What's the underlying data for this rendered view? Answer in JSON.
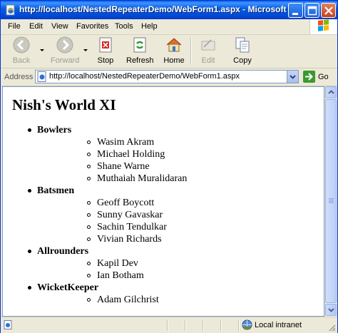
{
  "window": {
    "title": "http://localhost/NestedRepeaterDemo/WebForm1.aspx - Microsoft ..."
  },
  "menu": [
    "File",
    "Edit",
    "View",
    "Favorites",
    "Tools",
    "Help"
  ],
  "toolbar": {
    "back": "Back",
    "forward": "Forward",
    "stop": "Stop",
    "refresh": "Refresh",
    "home": "Home",
    "edit": "Edit",
    "copy": "Copy"
  },
  "address": {
    "label": "Address",
    "url": "http://localhost/NestedRepeaterDemo/WebForm1.aspx",
    "go": "Go"
  },
  "page": {
    "heading": "Nish's World XI",
    "categories": [
      {
        "label": "Bowlers",
        "players": [
          "Wasim Akram",
          "Michael Holding",
          "Shane Warne",
          "Muthaiah Muralidaran"
        ]
      },
      {
        "label": "Batsmen",
        "players": [
          "Geoff Boycott",
          "Sunny Gavaskar",
          "Sachin Tendulkar",
          "Vivian Richards"
        ]
      },
      {
        "label": "Allrounders",
        "players": [
          "Kapil Dev",
          "Ian Botham"
        ]
      },
      {
        "label": "WicketKeeper",
        "players": [
          "Adam Gilchrist"
        ]
      }
    ]
  },
  "status": {
    "zone": "Local intranet"
  },
  "colors": {
    "titlebar": "#0a5fe3",
    "chrome": "#ece9d8",
    "close": "#c4411e"
  }
}
